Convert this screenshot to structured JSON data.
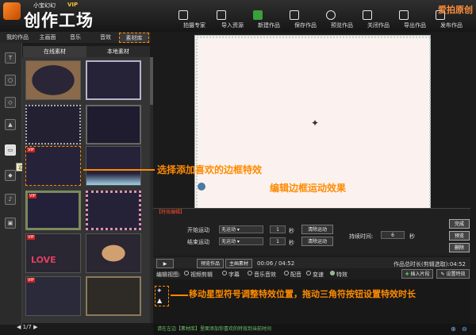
{
  "app": {
    "small_title": "小宝幻幻",
    "vip": "VIP",
    "name": "创作工场",
    "watermark": "爱拍原创"
  },
  "toolbar": [
    {
      "label": "拍摄专家",
      "icon": "camera-icon"
    },
    {
      "label": "导入资源",
      "icon": "import-icon"
    },
    {
      "label": "新建作品",
      "icon": "new-icon"
    },
    {
      "label": "保存作品",
      "icon": "save-icon"
    },
    {
      "label": "预览作品",
      "icon": "eye-icon"
    },
    {
      "label": "关闭作品",
      "icon": "close-icon"
    },
    {
      "label": "导出作品",
      "icon": "export-icon"
    },
    {
      "label": "发布作品",
      "icon": "publish-icon"
    }
  ],
  "tabs": [
    "我的作品",
    "主画面",
    "音乐",
    "音效",
    "素材库"
  ],
  "sidebar": {
    "tooltip": "边框"
  },
  "subtabs": [
    "在线素材",
    "本地素材"
  ],
  "thumbnails": [
    {
      "vip": ""
    },
    {
      "vip": ""
    },
    {
      "vip": ""
    },
    {
      "vip": ""
    },
    {
      "vip": "VIP"
    },
    {
      "vip": ""
    },
    {
      "vip": "VIP"
    },
    {
      "vip": ""
    },
    {
      "vip": "VIP"
    },
    {
      "vip": ""
    },
    {
      "vip": "VIP"
    },
    {
      "vip": ""
    }
  ],
  "thumb_text": "LOVE",
  "pager": "1/7",
  "annotations": {
    "select": "选择添加喜欢的边框特效",
    "edit": "编辑边框运动效果",
    "move": "移动星型符号调整特效位置，拖动三角符按钮设置特效时长"
  },
  "effects": {
    "title": "【特效编辑】",
    "start_label": "开始运动",
    "end_label": "结束运动",
    "start_value": "无运动",
    "end_value": "无运动",
    "start_num": "1",
    "end_num": "1",
    "unit": "秒",
    "clear": "清除运动",
    "duration_label": "持续时间:",
    "duration_value": "6",
    "done": "完成",
    "preview": "预览",
    "delete": "删除"
  },
  "transport": {
    "preview_work": "预览作品",
    "main_material": "主画素材",
    "time": "00:06 / 04:52",
    "total": "作品总时长(剪辑选取):04:52"
  },
  "view": {
    "label": "编辑视图:",
    "options": [
      "视频剪辑",
      "字幕",
      "音乐音效",
      "配音",
      "变速",
      "特效"
    ],
    "insert": "插入片段",
    "set_effect": "设置特效"
  },
  "status": "请在左边【素材库】里面添加你喜欢的特效到当前时间",
  "colors": {
    "accent": "#ff8a00",
    "status_text": "#6cc36c"
  }
}
